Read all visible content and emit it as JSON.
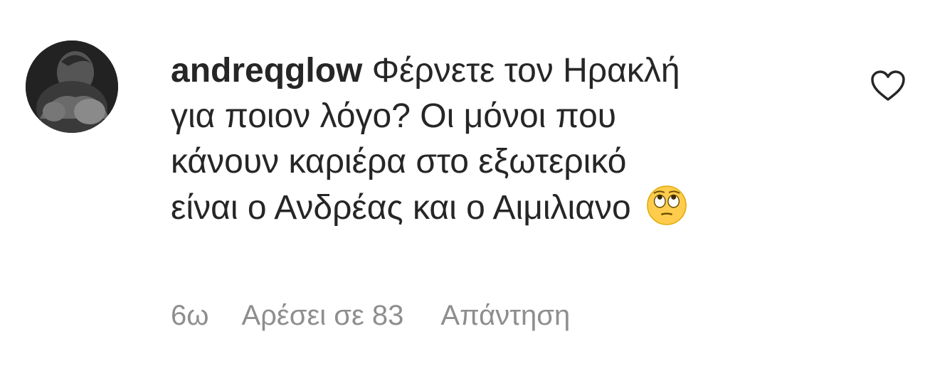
{
  "comment": {
    "username": "andreqglow",
    "lines": [
      "Φέρνετε τον Ηρακλή",
      "για ποιον λόγο? Οι μόνοι που",
      "κάνουν καριέρα στο εξωτερικό",
      "είναι ο Ανδρέας και ο Αιμιλιανο"
    ],
    "emoji": "face-with-rolling-eyes",
    "like_icon": "heart-outline-icon",
    "avatar": "profile-photo"
  },
  "meta": {
    "time": "6ω",
    "likes": "Αρέσει σε 83",
    "reply": "Απάντηση"
  },
  "colors": {
    "text": "#262626",
    "secondary": "#8e8e8e",
    "emoji_fill": "#ffcc4d"
  }
}
